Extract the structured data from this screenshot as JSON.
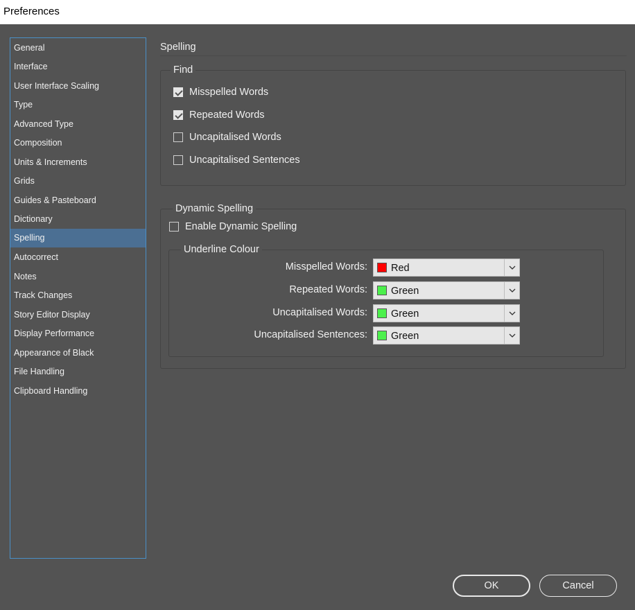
{
  "window": {
    "title": "Preferences"
  },
  "sidebar": {
    "items": [
      {
        "label": "General"
      },
      {
        "label": "Interface"
      },
      {
        "label": "User Interface Scaling"
      },
      {
        "label": "Type"
      },
      {
        "label": "Advanced Type"
      },
      {
        "label": "Composition"
      },
      {
        "label": "Units & Increments"
      },
      {
        "label": "Grids"
      },
      {
        "label": "Guides & Pasteboard"
      },
      {
        "label": "Dictionary"
      },
      {
        "label": "Spelling",
        "selected": true
      },
      {
        "label": "Autocorrect"
      },
      {
        "label": "Notes"
      },
      {
        "label": "Track Changes"
      },
      {
        "label": "Story Editor Display"
      },
      {
        "label": "Display Performance"
      },
      {
        "label": "Appearance of Black"
      },
      {
        "label": "File Handling"
      },
      {
        "label": "Clipboard Handling"
      }
    ]
  },
  "main": {
    "title": "Spelling",
    "find": {
      "label": "Find",
      "options": [
        {
          "label": "Misspelled Words",
          "checked": true
        },
        {
          "label": "Repeated Words",
          "checked": true
        },
        {
          "label": "Uncapitalised Words",
          "checked": false
        },
        {
          "label": "Uncapitalised Sentences",
          "checked": false
        }
      ]
    },
    "dynamic": {
      "label": "Dynamic Spelling",
      "enable": {
        "label": "Enable Dynamic Spelling",
        "checked": false
      },
      "underline": {
        "label": "Underline Colour",
        "rows": [
          {
            "label": "Misspelled Words:",
            "value": "Red",
            "color": "#ff0000"
          },
          {
            "label": "Repeated Words:",
            "value": "Green",
            "color": "#4cf04c"
          },
          {
            "label": "Uncapitalised Words:",
            "value": "Green",
            "color": "#4cf04c"
          },
          {
            "label": "Uncapitalised Sentences:",
            "value": "Green",
            "color": "#4cf04c"
          }
        ]
      }
    }
  },
  "buttons": {
    "ok": "OK",
    "cancel": "Cancel"
  }
}
